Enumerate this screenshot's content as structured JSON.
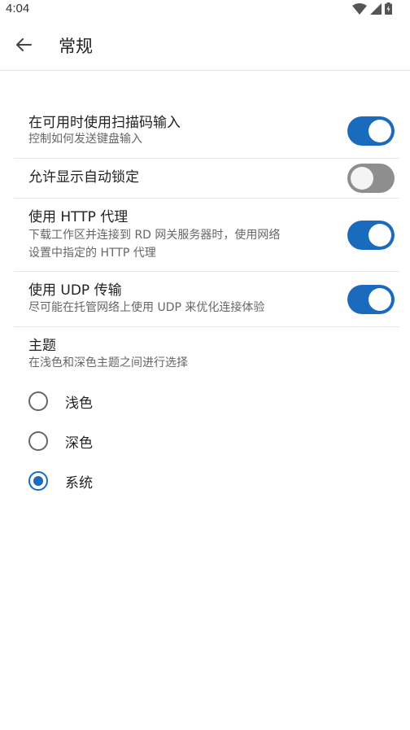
{
  "status_bar": {
    "time": "4:04",
    "icons": [
      "wifi-icon",
      "cellular-signal-icon",
      "battery-charging-icon"
    ]
  },
  "app_bar": {
    "back_icon": "arrow-left-icon",
    "title": "常规"
  },
  "settings": [
    {
      "title": "在可用时使用扫描码输入",
      "description": "控制如何发送键盘输入",
      "enabled": true
    },
    {
      "title": "允许显示自动锁定",
      "description": "",
      "enabled": false
    },
    {
      "title": "使用 HTTP 代理",
      "description_lines": [
        "下载工作区并连接到 RD 网关服务器时，使用网络",
        "设置中指定的 HTTP 代理"
      ],
      "enabled": true
    },
    {
      "title": "使用 UDP 传输",
      "description": "尽可能在托管网络上使用 UDP 来优化连接体验",
      "enabled": true
    }
  ],
  "theme": {
    "title": "主题",
    "description": "在浅色和深色主题之间进行选择",
    "options": [
      {
        "label": "浅色",
        "selected": false
      },
      {
        "label": "深色",
        "selected": false
      },
      {
        "label": "系统",
        "selected": true
      }
    ]
  },
  "colors": {
    "accent": "#1a6bbd",
    "toggle_off": "#8e8e8e"
  }
}
